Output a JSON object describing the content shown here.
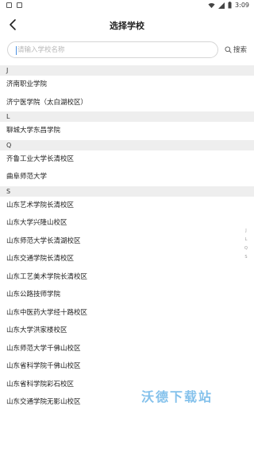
{
  "status": {
    "time": "3:09"
  },
  "header": {
    "title": "选择学校"
  },
  "search": {
    "placeholder": "请输入学校名称",
    "button_label": "搜索"
  },
  "sections": [
    {
      "letter": "J",
      "items": [
        "济南职业学院",
        "济宁医学院（太白湖校区）"
      ]
    },
    {
      "letter": "L",
      "items": [
        "聊城大学东昌学院"
      ]
    },
    {
      "letter": "Q",
      "items": [
        "齐鲁工业大学长清校区",
        "曲阜师范大学"
      ]
    },
    {
      "letter": "S",
      "items": [
        "山东艺术学院长清校区",
        "山东大学兴隆山校区",
        "山东师范大学长清湖校区",
        "山东交通学院长清校区",
        "山东工艺美术学院长清校区",
        "山东公路技师学院",
        "山东中医药大学经十路校区",
        "山东大学洪家楼校区",
        "山东师范大学千佛山校区",
        "山东省科学院千佛山校区",
        "山东省科学院彩石校区",
        "山东交通学院无影山校区"
      ]
    }
  ],
  "index_letters": [
    "J",
    "L",
    "Q",
    "S"
  ],
  "watermark": "沃德下载站"
}
